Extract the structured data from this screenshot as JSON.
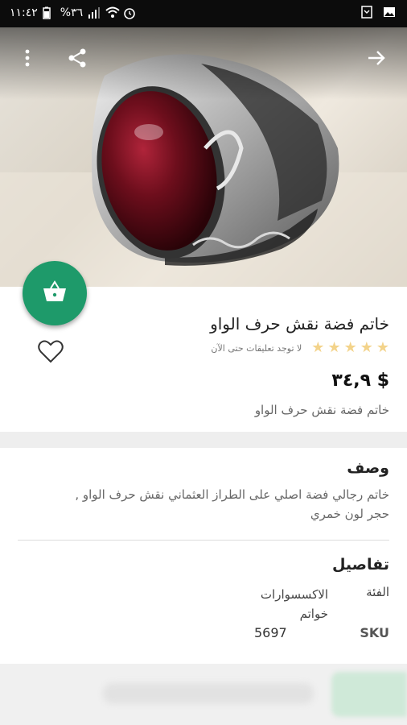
{
  "status_bar": {
    "time": "١١:٤٢",
    "battery": "%٣٦"
  },
  "product": {
    "title": "خاتم فضة نقش حرف الواو",
    "rating_stars": 5,
    "reviews_text": "لا توجد تعليقات حتى الآن",
    "price": "$ ٣٤,٩",
    "short_description": "خاتم فضة نقش حرف الواو",
    "description_heading": "وصف",
    "description": "خاتم  رجالي  فضة اصلي على الطراز العثماني  نقش حرف الواو , حجر لون خمري",
    "details_heading": "تفاصيل",
    "category_label": "الفئة",
    "category_value_line1": "الاكسسوارات",
    "category_value_line2": "خواتم",
    "sku_label": "SKU",
    "sku_value": "5697"
  },
  "colors": {
    "accent": "#1e9a6a",
    "star": "#f3d38a"
  },
  "icons": [
    "more-vert-icon",
    "share-icon",
    "forward-arrow-icon",
    "basket-icon",
    "heart-icon"
  ]
}
